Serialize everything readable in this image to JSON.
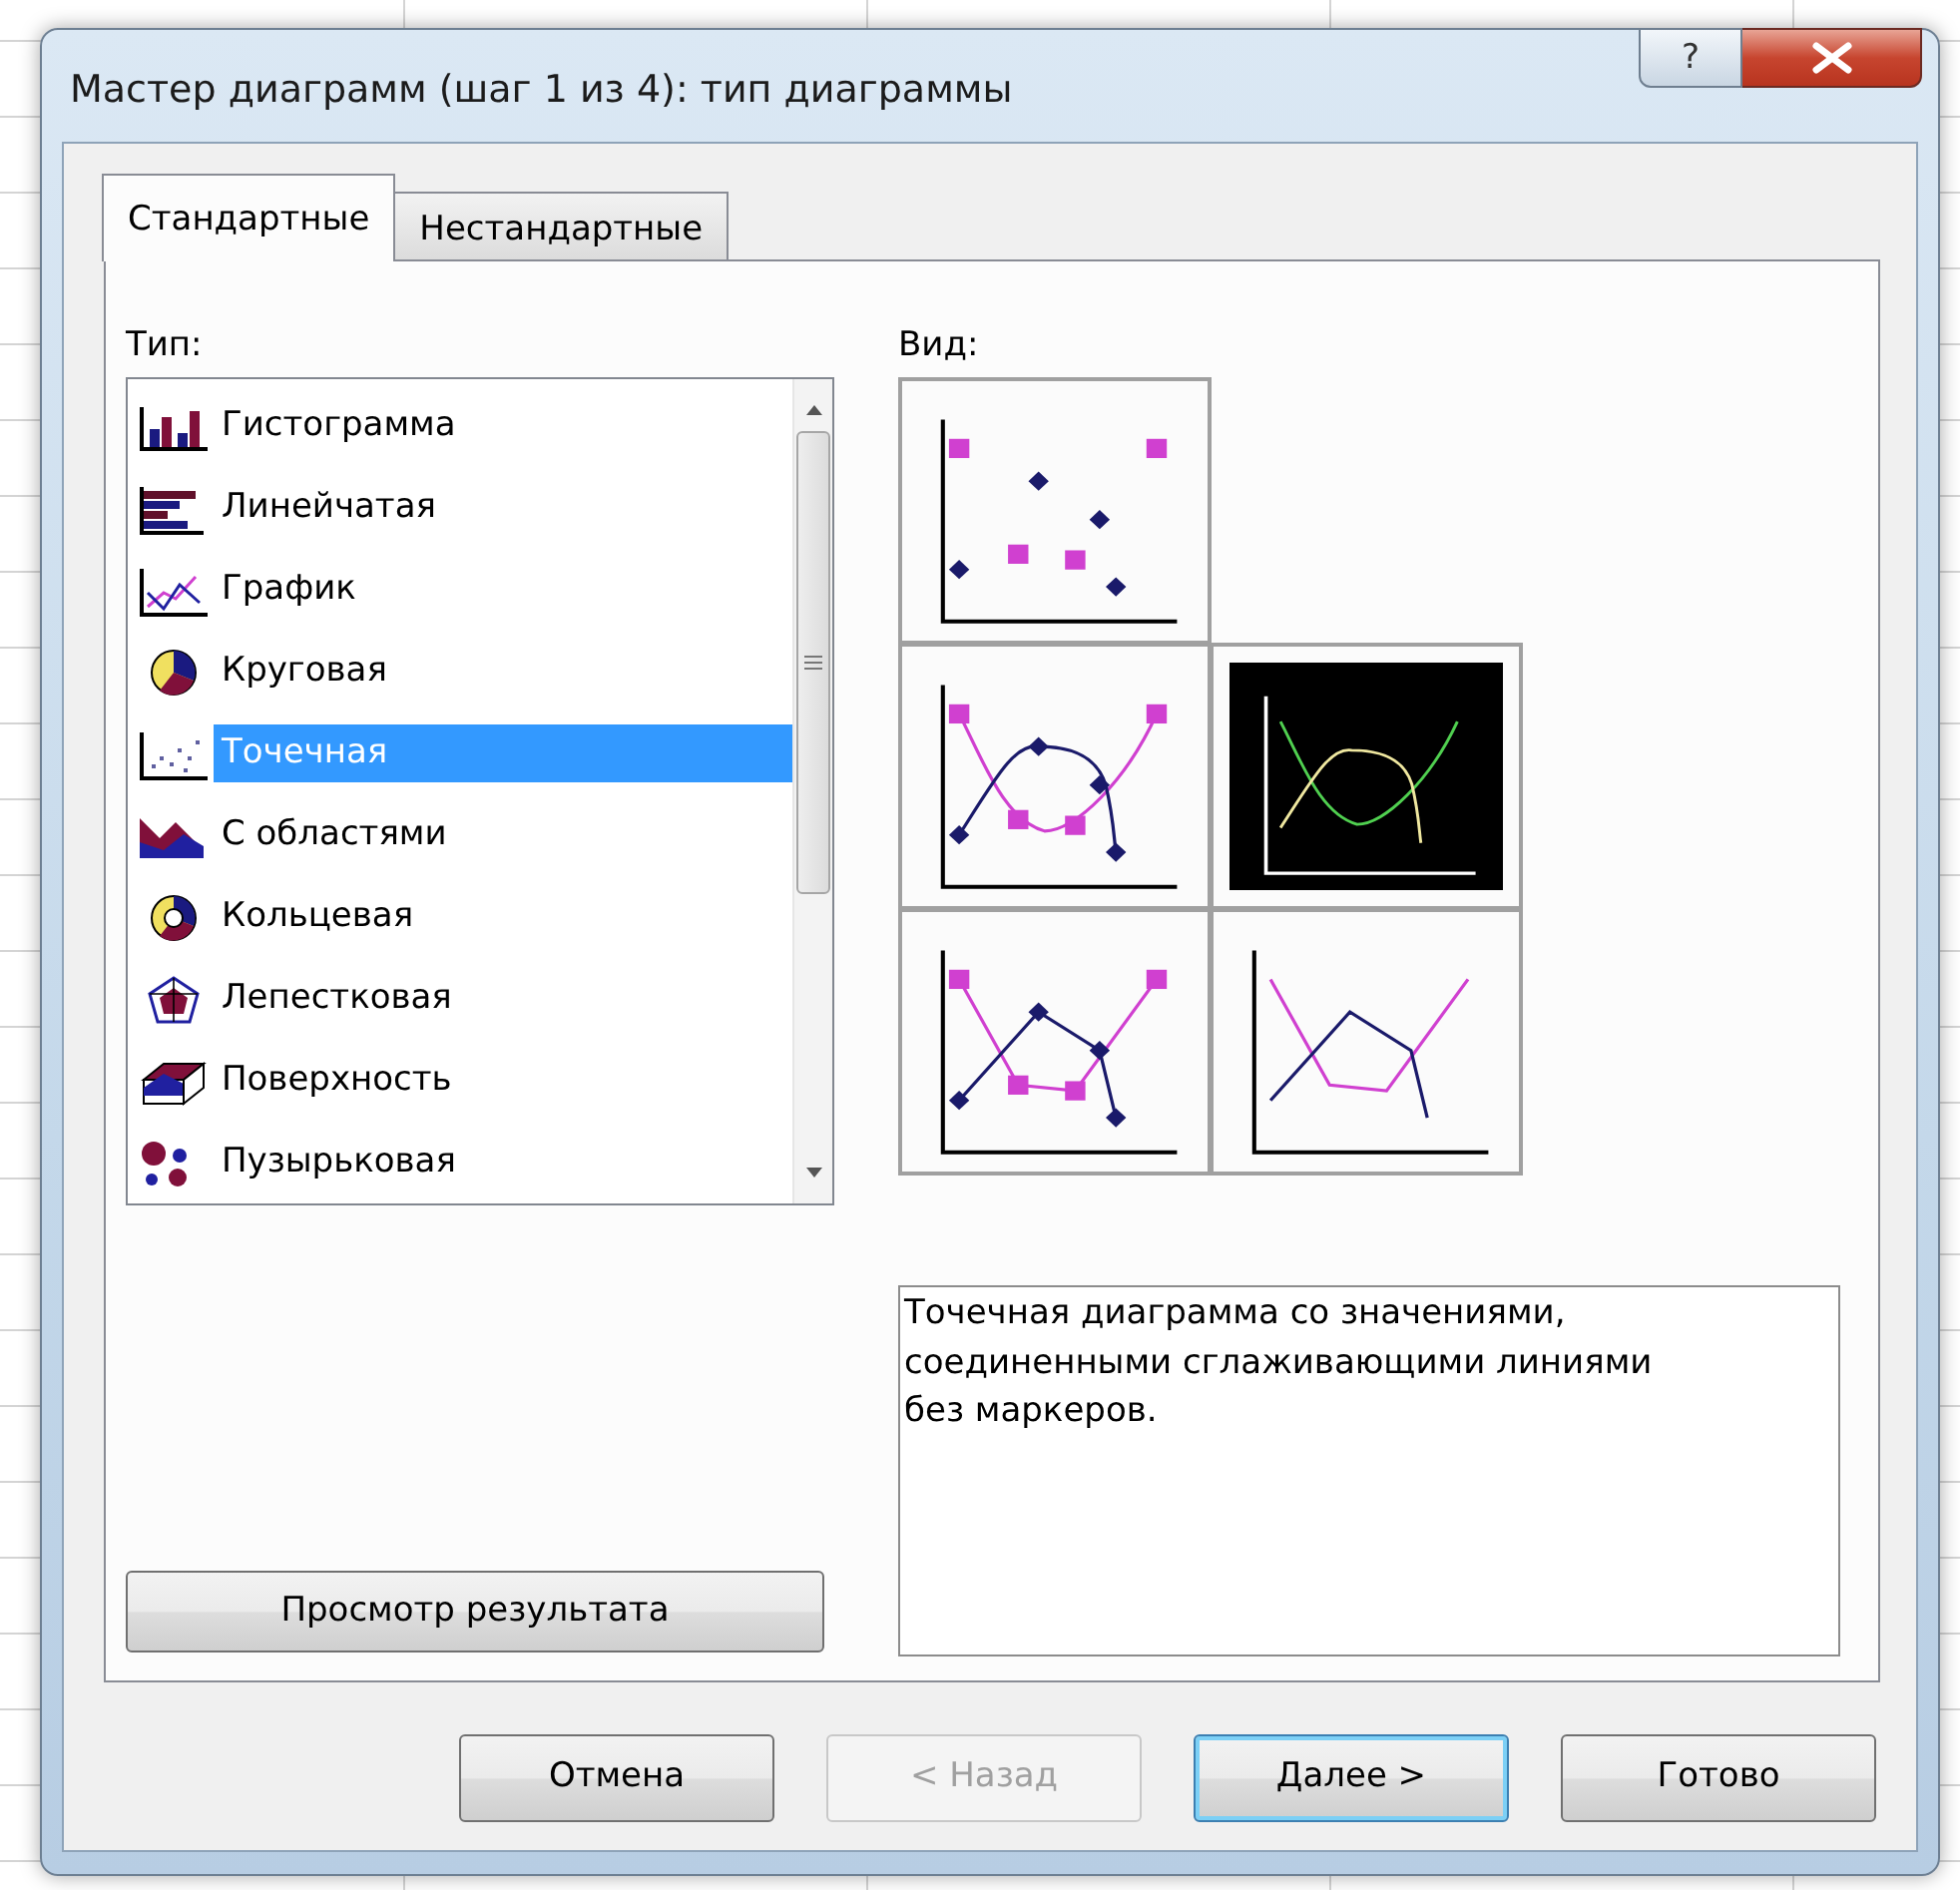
{
  "window": {
    "title": "Мастер диаграмм (шаг 1 из 4): тип диаграммы",
    "help_button": "?"
  },
  "tabs": [
    {
      "label": "Стандартные",
      "selected": true
    },
    {
      "label": "Нестандартные",
      "selected": false
    }
  ],
  "type_list": {
    "label": "Тип:",
    "items": [
      {
        "label": "Гистограмма",
        "kind": "column",
        "selected": false
      },
      {
        "label": "Линейчатая",
        "kind": "bar",
        "selected": false
      },
      {
        "label": "График",
        "kind": "line",
        "selected": false
      },
      {
        "label": "Круговая",
        "kind": "pie",
        "selected": false
      },
      {
        "label": "Точечная",
        "kind": "scatter",
        "selected": true
      },
      {
        "label": "С областями",
        "kind": "area",
        "selected": false
      },
      {
        "label": "Кольцевая",
        "kind": "doughnut",
        "selected": false
      },
      {
        "label": "Лепестковая",
        "kind": "radar",
        "selected": false
      },
      {
        "label": "Поверхность",
        "kind": "surface",
        "selected": false
      },
      {
        "label": "Пузырьковая",
        "kind": "bubble",
        "selected": false
      }
    ]
  },
  "subtypes": {
    "label": "Вид:",
    "items": [
      {
        "kind": "markers",
        "selected": false
      },
      {
        "kind": "smooth-markers",
        "selected": false
      },
      {
        "kind": "smooth",
        "selected": true
      },
      {
        "kind": "lines-markers",
        "selected": false
      },
      {
        "kind": "lines",
        "selected": false
      }
    ],
    "description": "Точечная диаграмма со значениями, соединенными сглаживающими линиями без маркеров."
  },
  "preview_button": "Просмотр результата",
  "buttons": [
    {
      "label": "Отмена",
      "disabled": false,
      "default": false
    },
    {
      "label": "< Назад",
      "disabled": true,
      "default": false
    },
    {
      "label": "Далее >",
      "disabled": false,
      "default": true
    },
    {
      "label": "Готово",
      "disabled": false,
      "default": false
    }
  ]
}
